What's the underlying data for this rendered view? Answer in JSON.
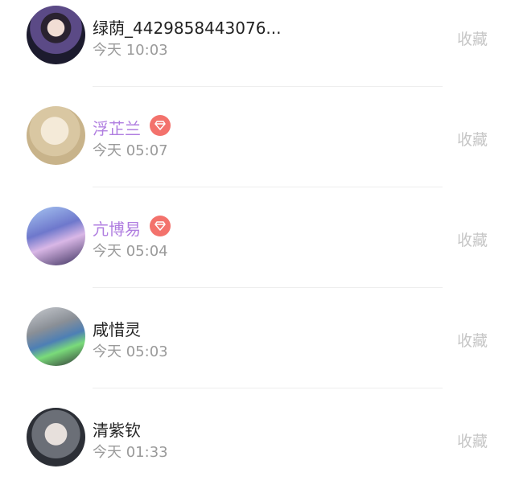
{
  "items": [
    {
      "name": "绿荫_4429858443076...",
      "time": "今天 10:03",
      "vip": false,
      "action": "收藏"
    },
    {
      "name": "浮芷兰",
      "time": "今天 05:07",
      "vip": true,
      "action": "收藏"
    },
    {
      "name": "亢博易",
      "time": "今天 05:04",
      "vip": true,
      "action": "收藏"
    },
    {
      "name": "咸惜灵",
      "time": "今天 05:03",
      "vip": false,
      "action": "收藏"
    },
    {
      "name": "清紫钦",
      "time": "今天 01:33",
      "vip": false,
      "action": "收藏"
    }
  ],
  "colors": {
    "vip_name": "#b07ee0",
    "vip_badge": "#f3726c",
    "name": "#222222",
    "time": "#9a9a9a",
    "action": "#c6c6c6"
  },
  "icons": {
    "vip_badge": "diamond-icon"
  }
}
